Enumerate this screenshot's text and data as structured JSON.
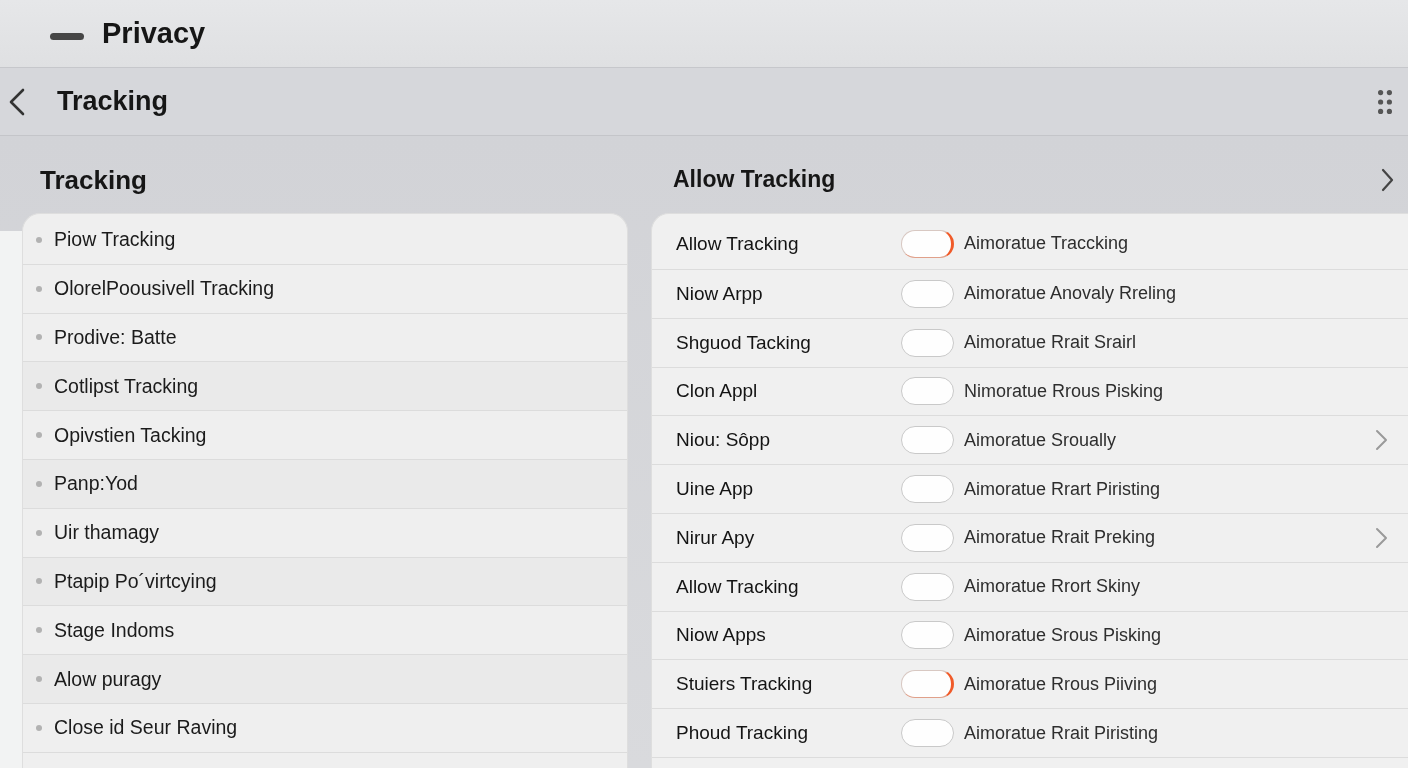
{
  "title_bar": {
    "title": "Privacy"
  },
  "nav_bar": {
    "title": "Tracking"
  },
  "left_panel": {
    "heading": "Tracking",
    "items": [
      "Piow Tracking",
      "OlorelPoousivell Tracking",
      "Prodive: Batte",
      "Cotlipst Tracking",
      "Opivstien Tacking",
      "Panp:Yod",
      "Uir thamagy",
      "Ptapip Po´virtcying",
      "Stage Indoms",
      "Alow puragy",
      "Close id Seur Raving"
    ]
  },
  "right_panel": {
    "heading": "Allow Tracking",
    "rows": [
      {
        "label": "Allow Tracking",
        "on": true,
        "description": "Aimoratue Traccking",
        "chevron": false
      },
      {
        "label": "Niow Arpp",
        "on": false,
        "description": "Aimoratue Anovaly Rreling",
        "chevron": false
      },
      {
        "label": "Shguod Tacking",
        "on": false,
        "description": "Aimoratue Rrait Srairl",
        "chevron": false
      },
      {
        "label": "Clon Appl",
        "on": false,
        "description": "Nimoratue Rrous Pisking",
        "chevron": false
      },
      {
        "label": "Niou: Sôpp",
        "on": false,
        "description": "Aimoratue Sroually",
        "chevron": true
      },
      {
        "label": "Uine App",
        "on": false,
        "description": "Aimoratue Rrart Piristing",
        "chevron": false
      },
      {
        "label": "Nirur Apy",
        "on": false,
        "description": "Aimoratue Rrait Preking",
        "chevron": true
      },
      {
        "label": "Allow Tracking",
        "on": false,
        "description": "Aimoratue Rrort Skiny",
        "chevron": false
      },
      {
        "label": "Niow Apps",
        "on": false,
        "description": "Aimoratue Srous Pisking",
        "chevron": false
      },
      {
        "label": "Stuiers Tracking",
        "on": true,
        "description": "Aimoratue Rrous Piiving",
        "chevron": false
      },
      {
        "label": "Phoud Tracking",
        "on": false,
        "description": "Aimoratue Rrait Piristing",
        "chevron": false
      }
    ]
  }
}
